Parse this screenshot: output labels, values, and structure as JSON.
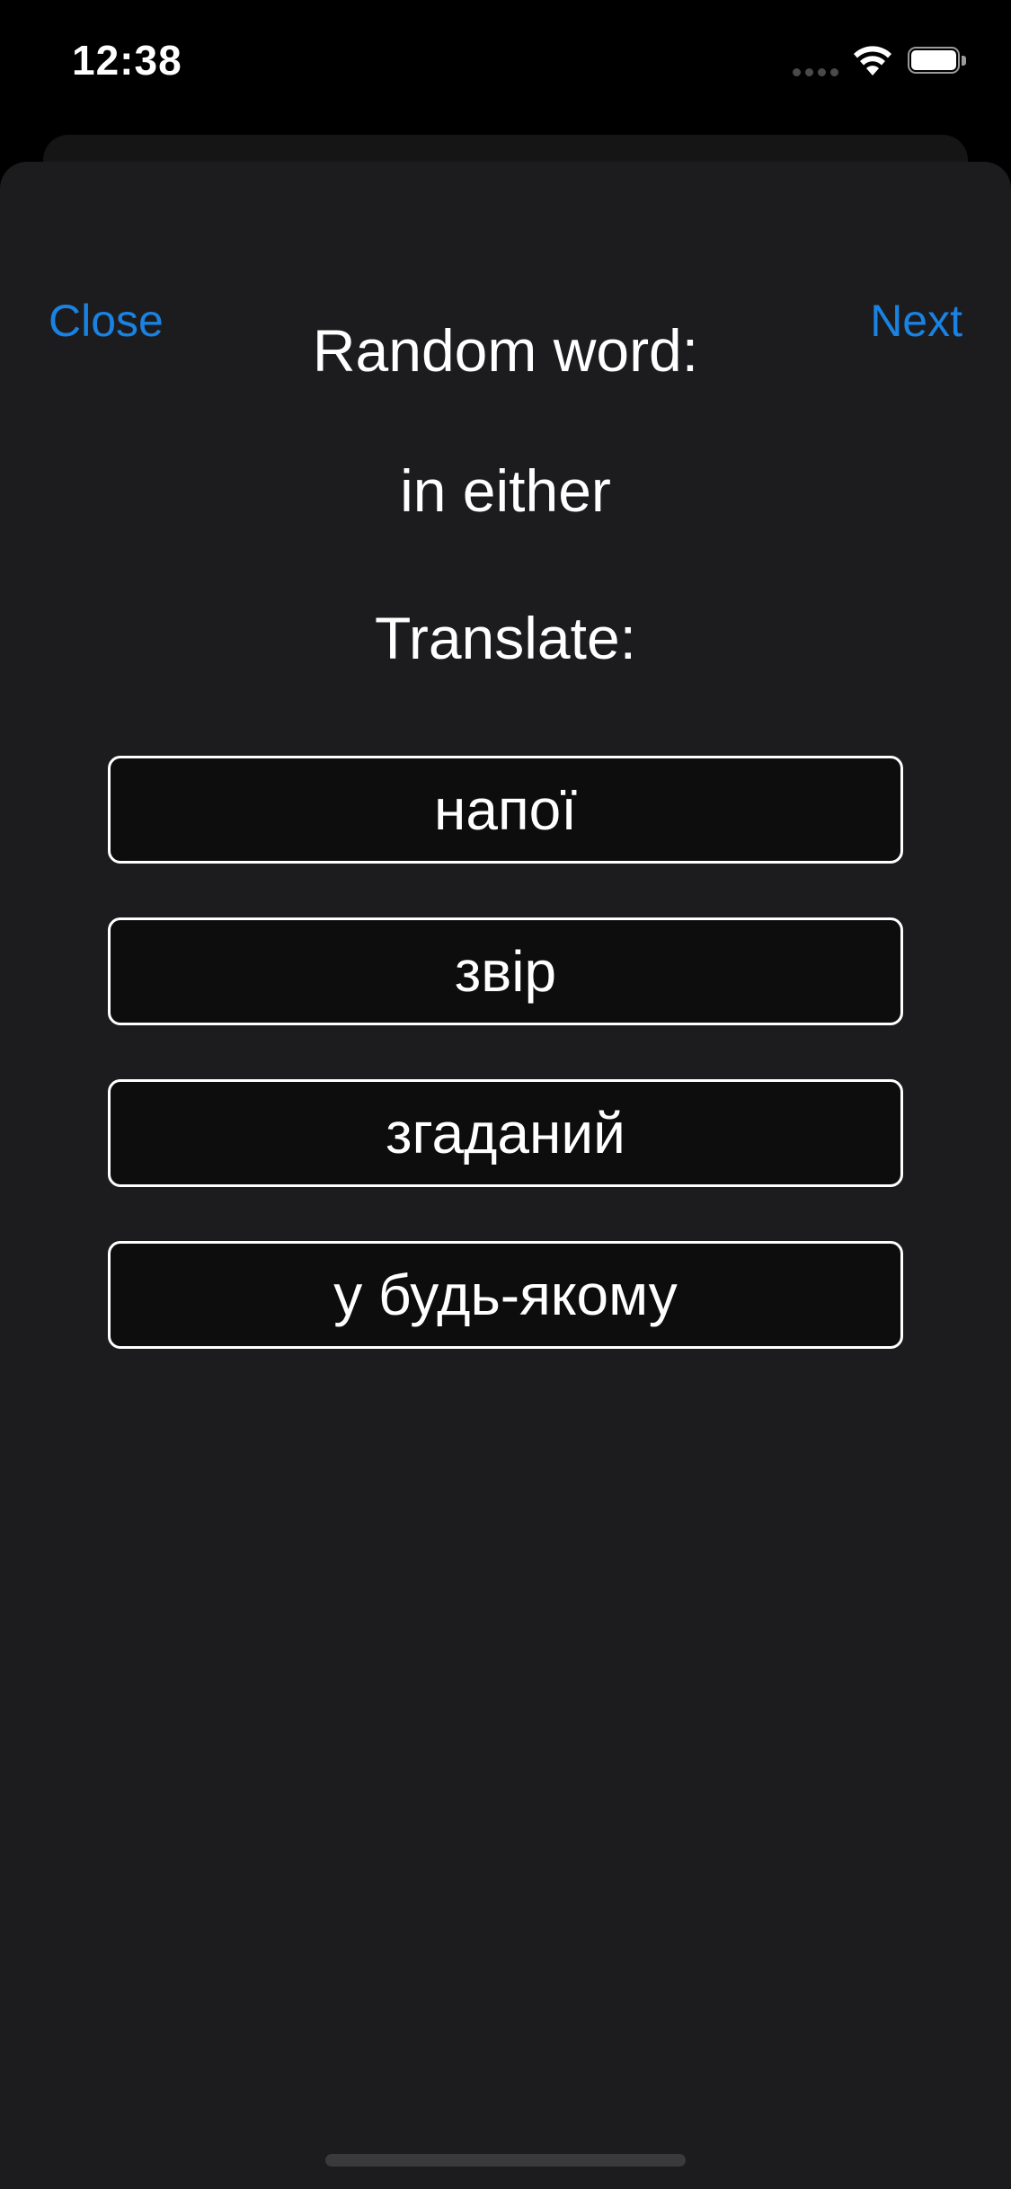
{
  "status_bar": {
    "time": "12:38",
    "icons": [
      "signal-icon",
      "wifi-icon",
      "battery-icon"
    ]
  },
  "nav": {
    "close_label": "Close",
    "next_label": "Next"
  },
  "quiz": {
    "title": "Random word:",
    "word": "in either",
    "translate_label": "Translate:",
    "options": [
      "напої",
      "звір",
      "згаданий",
      "у будь-якому"
    ]
  },
  "colors": {
    "accent": "#1a82e2",
    "sheet_background": "#1c1c1e",
    "option_background": "#0d0d0d",
    "option_border": "#ffffff"
  }
}
